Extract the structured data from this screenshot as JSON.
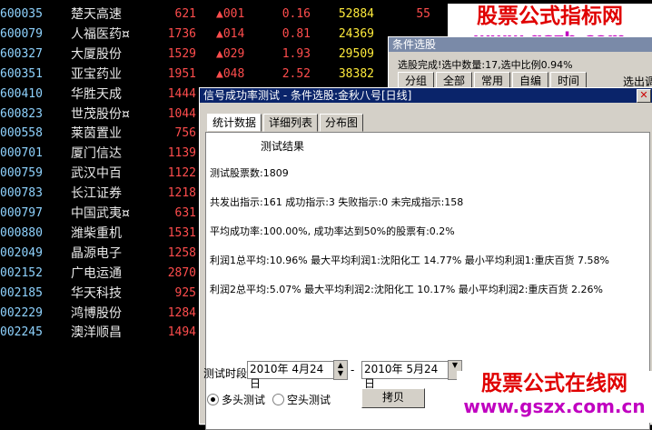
{
  "stocks": [
    {
      "code": "600035",
      "name": "楚天高速",
      "price": "621",
      "chg": "▲001",
      "pct": "0.16",
      "vol": "52884",
      "x": "55"
    },
    {
      "code": "600079",
      "name": "人福医药¤",
      "price": "1736",
      "chg": "▲014",
      "pct": "0.81",
      "vol": "24369",
      "x": ""
    },
    {
      "code": "600327",
      "name": "大厦股份",
      "price": "1529",
      "chg": "▲029",
      "pct": "1.93",
      "vol": "29509",
      "x": ""
    },
    {
      "code": "600351",
      "name": "亚宝药业",
      "price": "1951",
      "chg": "▲048",
      "pct": "2.52",
      "vol": "38382",
      "x": ""
    },
    {
      "code": "600410",
      "name": "华胜天成",
      "price": "1444",
      "chg": "",
      "pct": "",
      "vol": "",
      "x": ""
    },
    {
      "code": "600823",
      "name": "世茂股份¤",
      "price": "1044",
      "chg": "",
      "pct": "",
      "vol": "",
      "x": ""
    },
    {
      "code": "000558",
      "name": "莱茵置业",
      "price": "756",
      "chg": "",
      "pct": "",
      "vol": "",
      "x": ""
    },
    {
      "code": "000701",
      "name": "厦门信达",
      "price": "1139",
      "chg": "",
      "pct": "",
      "vol": "",
      "x": ""
    },
    {
      "code": "000759",
      "name": "武汉中百",
      "price": "1122",
      "chg": "",
      "pct": "",
      "vol": "",
      "x": ""
    },
    {
      "code": "000783",
      "name": "长江证券",
      "price": "1218",
      "chg": "",
      "pct": "",
      "vol": "",
      "x": ""
    },
    {
      "code": "000797",
      "name": "中国武夷¤",
      "price": "631",
      "chg": "",
      "pct": "",
      "vol": "",
      "x": ""
    },
    {
      "code": "000880",
      "name": "潍柴重机",
      "price": "1531",
      "chg": "",
      "pct": "",
      "vol": "",
      "x": ""
    },
    {
      "code": "002049",
      "name": "晶源电子",
      "price": "1258",
      "chg": "",
      "pct": "",
      "vol": "",
      "x": ""
    },
    {
      "code": "002152",
      "name": "广电运通",
      "price": "2870",
      "chg": "",
      "pct": "",
      "vol": "",
      "x": ""
    },
    {
      "code": "002185",
      "name": "华天科技",
      "price": "925",
      "chg": "",
      "pct": "",
      "vol": "",
      "x": ""
    },
    {
      "code": "002229",
      "name": "鸿博股份",
      "price": "1284",
      "chg": "",
      "pct": "",
      "vol": "",
      "x": ""
    },
    {
      "code": "002245",
      "name": "澳洋顺昌",
      "price": "1494",
      "chg": "",
      "pct": "",
      "vol": "",
      "x": ""
    }
  ],
  "watermark_top": {
    "line1": "股票公式指标网",
    "line2": "www.gszb.com"
  },
  "watermark_bottom": {
    "line1": "股票公式在线网",
    "line2": "www.gszx.com.cn"
  },
  "condition_window": {
    "title": "条件选股",
    "status": "选股完成!选中数量:17,选中比例0.94%",
    "tabs": [
      "分组",
      "全部",
      "常用",
      "自编",
      "时间"
    ],
    "extra": "选出调"
  },
  "test_window": {
    "title": "信号成功率测试 - 条件选股:金秋八号[日线]",
    "tabs": [
      "统计数据",
      "详细列表",
      "分布图"
    ],
    "report": {
      "heading": "测试结果",
      "line1": "测试股票数:1809",
      "line2": "共发出指示:161 成功指示:3 失败指示:0 未完成指示:158",
      "line3": "平均成功率:100.00%, 成功率达到50%的股票有:0.2%",
      "line4": "利润1总平均:10.96% 最大平均利润1:沈阳化工 14.77% 最小平均利润1:重庆百货 7.58%",
      "line5": "利润2总平均:5.07% 最大平均利润2:沈阳化工 10.17% 最小平均利润2:重庆百货 2.26%"
    },
    "period_label": "测试时段",
    "date_from": "2010年 4月24日",
    "date_sep": "-",
    "date_to": "2010年 5月24日",
    "radio_long": "多头测试",
    "radio_short": "空头测试",
    "copy_button": "拷贝"
  }
}
